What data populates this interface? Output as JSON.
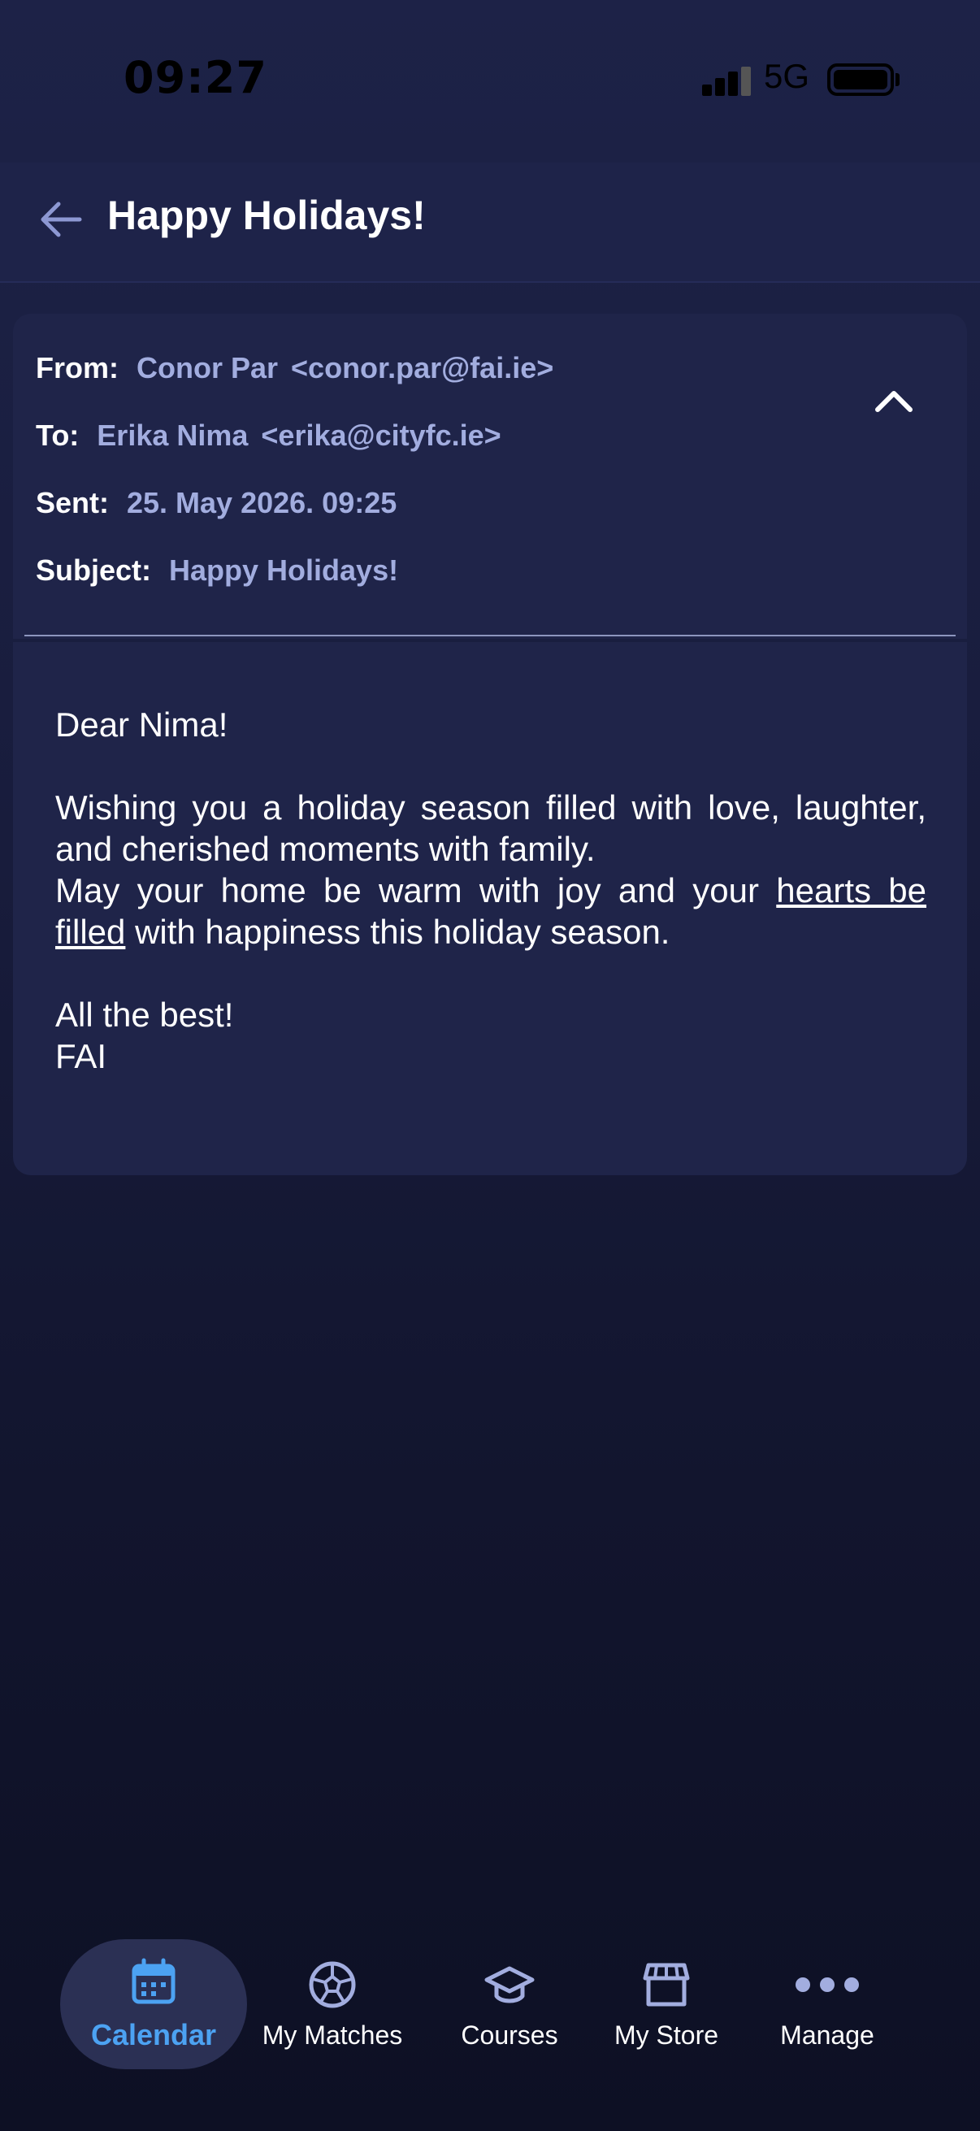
{
  "status_bar": {
    "time": "09:27",
    "network": "5G"
  },
  "header": {
    "title": "Happy Holidays!"
  },
  "email": {
    "from_label": "From:",
    "from_name": "Conor Par",
    "from_email": "<conor.par@fai.ie>",
    "to_label": "To:",
    "to_name": "Erika Nima",
    "to_email": "<erika@cityfc.ie>",
    "sent_label": "Sent:",
    "sent_value": "25. May 2026. 09:25",
    "subject_label": "Subject:",
    "subject_value": "Happy Holidays!",
    "greeting": "Dear Nima!",
    "paragraph_part1": "Wishing you a holiday season filled with love, laughter, and cherished moments with family.",
    "paragraph_part2": "May your home be warm with joy and your",
    "link_text": "hearts be filled",
    "paragraph_part3": "with happiness this holiday season.",
    "closing": "All the best!",
    "signature": "FAI"
  },
  "nav": {
    "items": [
      {
        "label": "Calendar",
        "icon": "calendar-icon",
        "active": true
      },
      {
        "label": "My Matches",
        "icon": "soccer-ball-icon",
        "active": false
      },
      {
        "label": "Courses",
        "icon": "graduation-cap-icon",
        "active": false
      },
      {
        "label": "My Store",
        "icon": "store-icon",
        "active": false
      },
      {
        "label": "Manage",
        "icon": "more-dots-icon",
        "active": false
      }
    ]
  },
  "colors": {
    "accent": "#4ca2f2",
    "meta_value": "#a2addf",
    "card": "#1f2449",
    "header": "#1e2349"
  }
}
